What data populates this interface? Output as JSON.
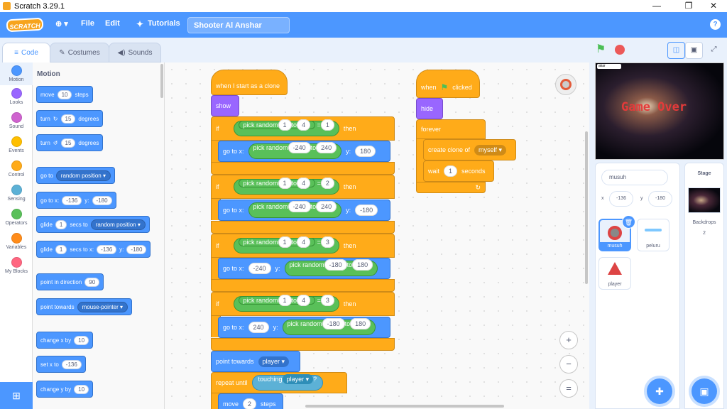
{
  "window": {
    "title": "Scratch 3.29.1",
    "minimize": "—",
    "maximize": "❐",
    "close": "✕"
  },
  "menu": {
    "logo": "SCRATCH",
    "globe": "⊕ ▾",
    "file": "File",
    "edit": "Edit",
    "tutorials": "Tutorials",
    "project_name": "Shooter Al Anshar",
    "help": "?"
  },
  "tabs": [
    {
      "label": "Code"
    },
    {
      "label": "Costumes"
    },
    {
      "label": "Sounds"
    }
  ],
  "categories": [
    {
      "label": "Motion",
      "color": "#4c97ff"
    },
    {
      "label": "Looks",
      "color": "#9966ff"
    },
    {
      "label": "Sound",
      "color": "#cf63cf"
    },
    {
      "label": "Events",
      "color": "#ffbf00"
    },
    {
      "label": "Control",
      "color": "#ffab19"
    },
    {
      "label": "Sensing",
      "color": "#5cb1d6"
    },
    {
      "label": "Operators",
      "color": "#59c059"
    },
    {
      "label": "Variables",
      "color": "#ff8c1a"
    },
    {
      "label": "My Blocks",
      "color": "#ff6680"
    }
  ],
  "palette": {
    "title": "Motion",
    "move": {
      "a": "move",
      "n": "10",
      "b": "steps"
    },
    "turn_right": {
      "a": "turn",
      "n": "15",
      "b": "degrees"
    },
    "turn_left": {
      "a": "turn",
      "n": "15",
      "b": "degrees"
    },
    "goto": {
      "a": "go to",
      "dd": "random position ▾"
    },
    "gotoxy": {
      "a": "go to x:",
      "x": "-136",
      "b": "y:",
      "y": "-180"
    },
    "glide": {
      "a": "glide",
      "n": "1",
      "b": "secs to",
      "dd": "random position ▾"
    },
    "glidexy": {
      "a": "glide",
      "n": "1",
      "b": "secs to x:",
      "x": "-136",
      "c": "y:",
      "y": "-180"
    },
    "point_dir": {
      "a": "point in direction",
      "n": "90"
    },
    "point_towards": {
      "a": "point towards",
      "dd": "mouse-pointer ▾"
    },
    "change_x": {
      "a": "change x by",
      "n": "10"
    },
    "set_x": {
      "a": "set x to",
      "n": "-136"
    },
    "change_y": {
      "a": "change y by",
      "n": "10"
    }
  },
  "script1": {
    "hat": "when I start as a clone",
    "show": "show",
    "if_label": "if",
    "then_label": "then",
    "pick_random": "pick random",
    "to": "to",
    "eq": "=",
    "goto_x": "go to x:",
    "y": "y:",
    "if1": {
      "a": "1",
      "b": "4",
      "v": "1",
      "x1": "-240",
      "x2": "240",
      "y": "180"
    },
    "if2": {
      "a": "1",
      "b": "4",
      "v": "2",
      "x1": "-240",
      "x2": "240",
      "y": "-180"
    },
    "if3": {
      "a": "1",
      "b": "4",
      "v": "3",
      "x": "-240",
      "y1": "-180",
      "y2": "180"
    },
    "if4": {
      "a": "1",
      "b": "4",
      "v": "3",
      "x": "240",
      "y1": "-180",
      "y2": "180"
    },
    "point_towards": "point towards",
    "point_target": "player ▾",
    "repeat_until": "repeat until",
    "touching": "touching",
    "touch_target": "player ▾",
    "q": "?",
    "move": "move",
    "move_n": "2",
    "steps": "steps"
  },
  "script2": {
    "when": "when",
    "clicked": "clicked",
    "hide": "hide",
    "forever": "forever",
    "create_clone": "create clone of",
    "clone_target": "myself ▾",
    "wait": "wait",
    "wait_n": "1",
    "seconds": "seconds",
    "loop_arrow": "↻"
  },
  "zoom": {
    "in": "+",
    "out": "−",
    "reset": "="
  },
  "stage": {
    "game_over": "Game Over",
    "ask_label": "akar"
  },
  "sprite_info": {
    "name": "musuh",
    "x_label": "x",
    "x": "-136",
    "y_label": "y",
    "y": "-180"
  },
  "sprites": [
    {
      "name": "musuh"
    },
    {
      "name": "peluru"
    },
    {
      "name": "player"
    }
  ],
  "stage_panel": {
    "title": "Stage",
    "backdrops_label": "Backdrops",
    "backdrops_count": "2"
  }
}
